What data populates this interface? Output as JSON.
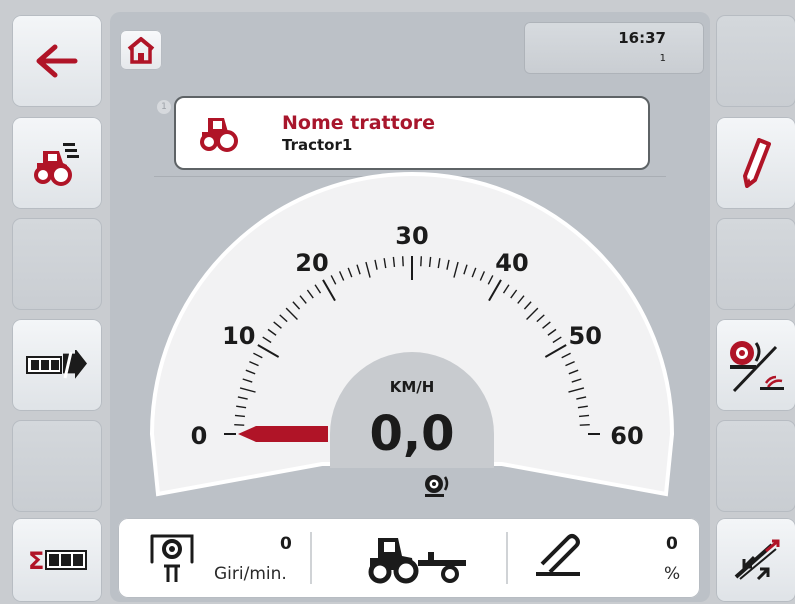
{
  "topbar": {
    "time": "16:37",
    "small_number": "1"
  },
  "tractor_card": {
    "index": "1",
    "title": "Nome trattore",
    "name": "Tractor1"
  },
  "gauge": {
    "unit": "KM/H",
    "speed_text": "0,0",
    "speed_value": 0,
    "min": 0,
    "max": 60,
    "tick_labels": [
      "0",
      "10",
      "20",
      "30",
      "40",
      "50",
      "60"
    ]
  },
  "bottom": {
    "rpm": {
      "value": "0",
      "unit": "Giri/min."
    },
    "lift": {
      "value": "0",
      "unit": "%"
    }
  },
  "colors": {
    "accent": "#a8162c",
    "background": "#c9ccd0"
  },
  "icons": {
    "left": [
      "arrow-left-icon",
      "tractor-list-icon",
      "",
      "counter-transfer-icon",
      "",
      "sum-counter-icon"
    ],
    "right": [
      "",
      "pencil-icon",
      "",
      "wheel-sensor-icon",
      "",
      "calibrate-icon"
    ]
  }
}
